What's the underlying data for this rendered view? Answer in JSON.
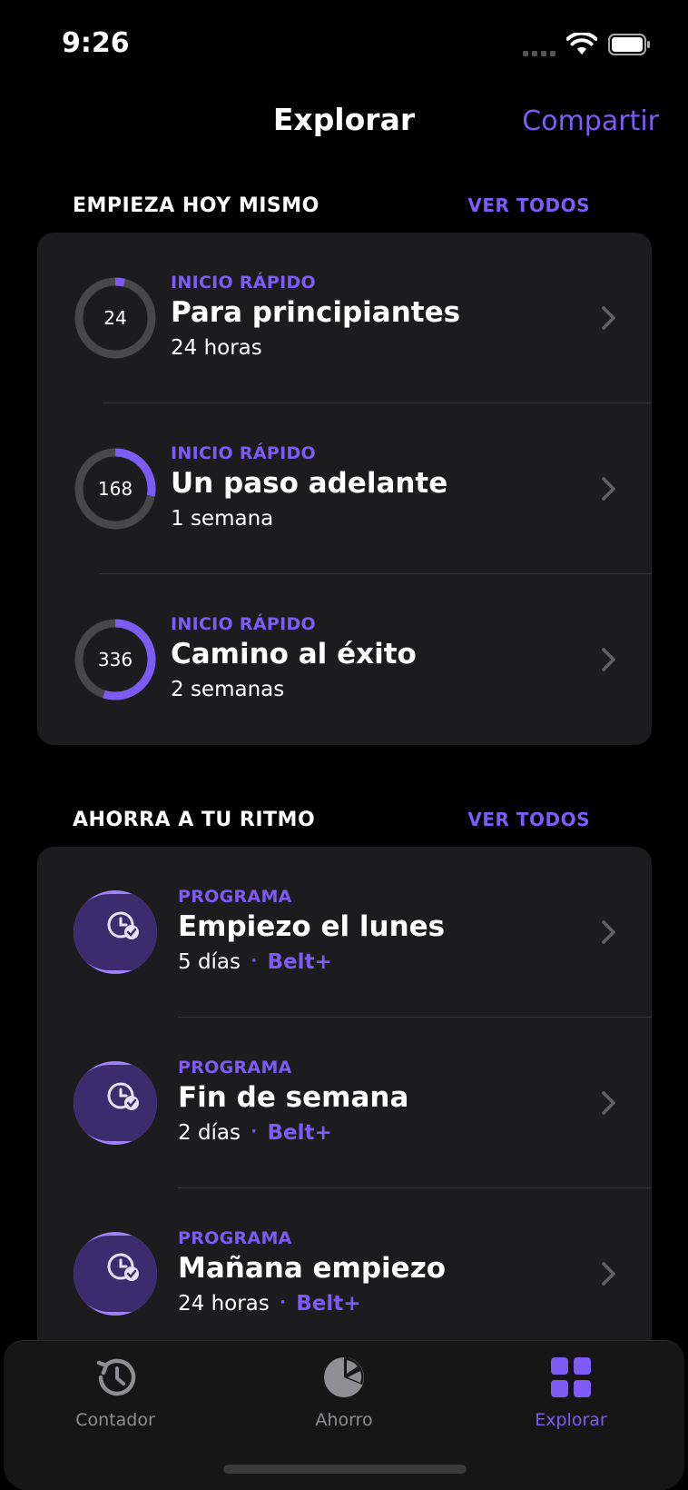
{
  "status_bar": {
    "time": "9:26"
  },
  "nav": {
    "title": "Explorar",
    "share_label": "Compartir"
  },
  "colors": {
    "accent": "#7c5cf5",
    "card": "#1c1c1e",
    "ring_track": "#48484a",
    "avatar": "#9d83f7"
  },
  "section_quick": {
    "title": "EMPIEZA HOY MISMO",
    "link": "VER TODOS",
    "items": [
      {
        "ring_value": "24",
        "progress": 0.04,
        "kicker": "INICIO RÁPIDO",
        "title": "Para principiantes",
        "subtitle": "24 horas"
      },
      {
        "ring_value": "168",
        "progress": 0.28,
        "kicker": "INICIO RÁPIDO",
        "title": "Un paso adelante",
        "subtitle": "1 semana"
      },
      {
        "ring_value": "336",
        "progress": 0.55,
        "kicker": "INICIO RÁPIDO",
        "title": "Camino al éxito",
        "subtitle": "2 semanas"
      }
    ]
  },
  "section_programs": {
    "title": "AHORRA A TU RITMO",
    "link": "VER TODOS",
    "items": [
      {
        "icon": "clock-check-icon",
        "kicker": "PROGRAMA",
        "title": "Empiezo el lunes",
        "subtitle": "5 días",
        "separator": "·",
        "badge": "Belt+"
      },
      {
        "icon": "clock-check-icon",
        "kicker": "PROGRAMA",
        "title": "Fin de semana",
        "subtitle": "2 días",
        "separator": "·",
        "badge": "Belt+"
      },
      {
        "icon": "clock-check-icon",
        "kicker": "PROGRAMA",
        "title": "Mañana empiezo",
        "subtitle": "24 horas",
        "separator": "·",
        "badge": "Belt+"
      }
    ]
  },
  "tab_bar": {
    "tabs": [
      {
        "label": "Contador",
        "icon": "history-icon",
        "active": false
      },
      {
        "label": "Ahorro",
        "icon": "pie-chart-icon",
        "active": false
      },
      {
        "label": "Explorar",
        "icon": "grid-icon",
        "active": true
      }
    ]
  }
}
